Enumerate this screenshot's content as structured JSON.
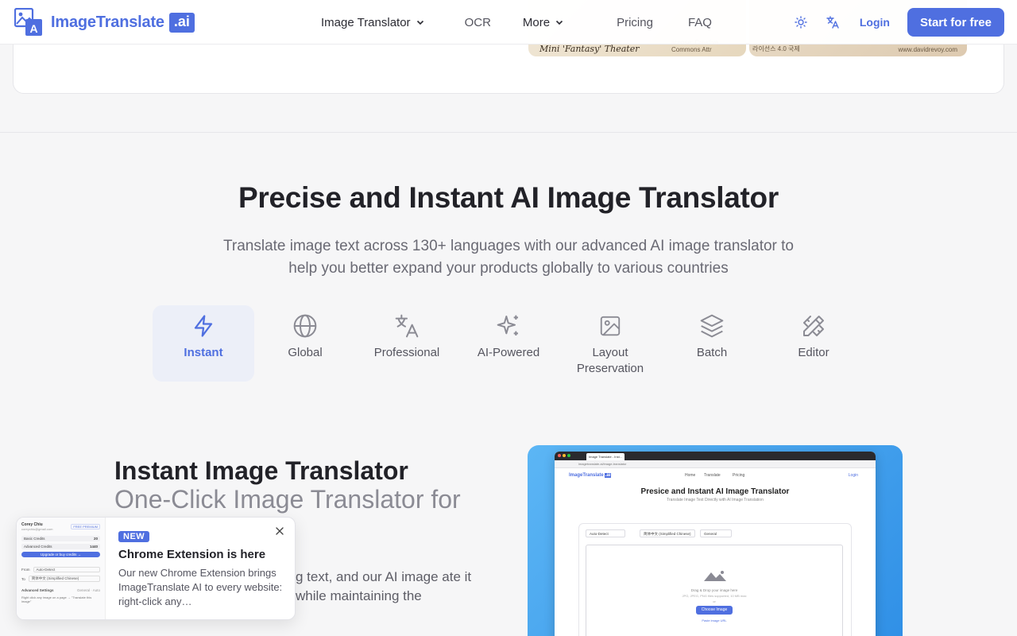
{
  "brand": {
    "name": "ImageTranslate",
    "suffix": ".ai"
  },
  "nav": {
    "links": [
      {
        "label": "Image Translator",
        "dropdown": true
      },
      {
        "label": "OCR",
        "dropdown": false
      },
      {
        "label": "More",
        "dropdown": true
      },
      {
        "label": "Pricing",
        "dropdown": false
      },
      {
        "label": "FAQ",
        "dropdown": false
      }
    ],
    "login": "Login",
    "cta": "Start for free"
  },
  "top_card": {
    "thumb_a_title": "Mini 'Fantasy' Theater",
    "thumb_a_caption": "license: Creative Commons Attr",
    "thumb_b_caption_a": "라이선스 4.0 국제",
    "thumb_b_caption_b": "www.davidrevoy.com"
  },
  "hero": {
    "title": "Precise and Instant AI Image Translator",
    "subtitle": "Translate image text across 130+ languages with our advanced AI image translator to help you better expand your products globally to various countries"
  },
  "features": [
    {
      "label": "Instant",
      "icon": "lightning-icon",
      "active": true
    },
    {
      "label": "Global",
      "icon": "globe-icon",
      "active": false
    },
    {
      "label": "Professional",
      "icon": "translate-icon",
      "active": false
    },
    {
      "label": "AI-Powered",
      "icon": "sparkles-icon",
      "active": false
    },
    {
      "label": "Layout Preservation",
      "icon": "image-icon",
      "active": false
    },
    {
      "label": "Batch",
      "icon": "layers-icon",
      "active": false
    },
    {
      "label": "Editor",
      "icon": "pencil-ruler-icon",
      "active": false
    }
  ],
  "section": {
    "title": "Instant Image Translator",
    "subtitle": "One-Click Image Translator for",
    "body": "g text, and our AI image ate it while maintaining the"
  },
  "mock": {
    "tab": "Image Translate - Inst...",
    "url": "imagetranslate.ai/image-translator",
    "logo": "ImageTranslate",
    "logo_suffix": ".ai",
    "nav_home": "Home",
    "nav_translate": "Translate",
    "nav_pricing": "Pricing",
    "nav_login": "Login",
    "title": "Presice and Instant AI Image Translator",
    "subtitle": "Translate Image Text Directly with AI Image Translation",
    "from": "Auto-Detect",
    "to": "简体中文 (Simplified Chinese)",
    "mode": "General",
    "drop_text": "Drag & Drop your image here",
    "drop_sub": "JPG, JPEG, PNG files supported, 10 MB max",
    "or": "or",
    "choose": "Choose Image",
    "paste": "Paste image URL"
  },
  "toast": {
    "badge": "NEW",
    "title": "Chrome Extension is here",
    "desc": "Our new Chrome Extension brings ImageTranslate AI to every website: right-click any…",
    "preview": {
      "name": "Corey Chiu",
      "email": "coreychiu@gmail.com",
      "pro": "FREE PREMIUM",
      "basic_label": "Basic Credits",
      "basic_val": "20",
      "adv_label": "Advanced Credits",
      "adv_val": "1440",
      "upgrade": "Upgrade or buy credits →",
      "from_label": "From",
      "from_val": "Auto-Detect",
      "to_label": "To",
      "to_val": "简体中文 (Simplified Chinese)",
      "adv_settings": "Advanced Settings",
      "adv_settings_val": "General · Auto",
      "hint": "Right click any image on a page → \"Translate this image\""
    }
  },
  "colors": {
    "accent": "#4f6fe0",
    "text": "#222228",
    "muted": "#8b8b94"
  }
}
